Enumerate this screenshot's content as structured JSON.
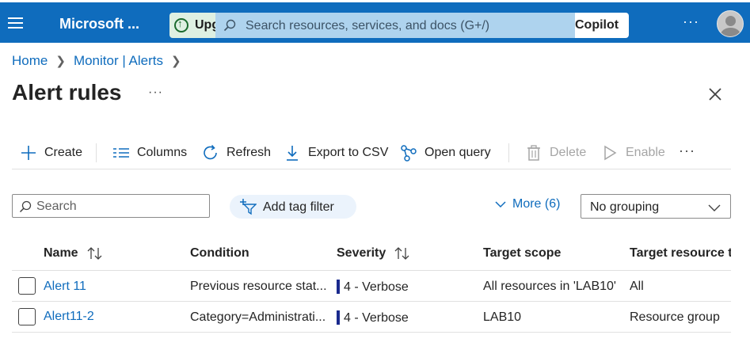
{
  "topbar": {
    "brand": "Microsoft ...",
    "upgrade_label": "Upg",
    "search_placeholder": "Search resources, services, and docs (G+/)",
    "copilot_label": "Copilot",
    "more": "···"
  },
  "breadcrumb": {
    "items": [
      "Home",
      "Monitor | Alerts"
    ]
  },
  "page": {
    "title": "Alert rules",
    "more": "···"
  },
  "toolbar": {
    "create": "Create",
    "columns": "Columns",
    "refresh": "Refresh",
    "export": "Export to CSV",
    "open_query": "Open query",
    "delete": "Delete",
    "enable": "Enable",
    "more": "···"
  },
  "filters": {
    "search_placeholder": "Search",
    "add_tag_filter": "Add tag filter",
    "more_filters": "More (6)",
    "grouping_value": "No grouping"
  },
  "table": {
    "columns": [
      "Name",
      "Condition",
      "Severity",
      "Target scope",
      "Target resource ty"
    ],
    "rows": [
      {
        "name": "Alert 11",
        "condition": "Previous resource stat...",
        "severity": "4 - Verbose",
        "target_scope": "All resources in 'LAB10'",
        "target_resource_type": "All"
      },
      {
        "name": "Alert11-2",
        "condition": "Category=Administrati...",
        "severity": "4 - Verbose",
        "target_scope": "LAB10",
        "target_resource_type": "Resource group"
      }
    ]
  },
  "colors": {
    "header_bg": "#0f6cbd",
    "link": "#0f6cbd",
    "severity_verbose": "#1a2a8e"
  }
}
